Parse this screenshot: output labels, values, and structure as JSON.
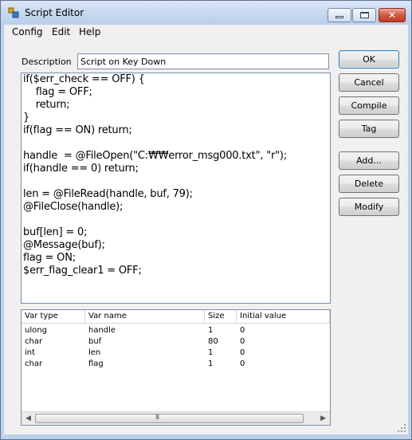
{
  "window": {
    "title": "Script Editor"
  },
  "menu": {
    "config": "Config",
    "edit": "Edit",
    "help": "Help"
  },
  "description": {
    "label": "Description",
    "value": "Script on Key Down"
  },
  "code_lines": [
    "if($err_check == OFF) {",
    "    flag = OFF;",
    "    return;",
    "}",
    "if(flag == ON) return;",
    "",
    "handle  = @FileOpen(\"C:₩₩error_msg000.txt\", \"r\");",
    "if(handle == 0) return;",
    "",
    "len = @FileRead(handle, buf, 79);",
    "@FileClose(handle);",
    "",
    "buf[len] = 0;",
    "@Message(buf);",
    "flag = ON;",
    "$err_flag_clear1 = OFF;"
  ],
  "variables": {
    "columns": [
      "Var type",
      "Var name",
      "Size",
      "Initial value"
    ],
    "rows": [
      [
        "ulong",
        "handle",
        "1",
        "0"
      ],
      [
        "char",
        "buf",
        "80",
        "0"
      ],
      [
        "int",
        "len",
        "1",
        "0"
      ],
      [
        "char",
        "flag",
        "1",
        "0"
      ]
    ],
    "scroll_grip": "III"
  },
  "buttons": {
    "ok": "OK",
    "cancel": "Cancel",
    "compile": "Compile",
    "tag": "Tag",
    "add": "Add...",
    "delete": "Delete",
    "modify": "Modify"
  },
  "icons": {
    "app": "script-editor-app-icon",
    "minimize": "minimize-icon",
    "maximize": "maximize-icon",
    "close": "close-icon"
  }
}
